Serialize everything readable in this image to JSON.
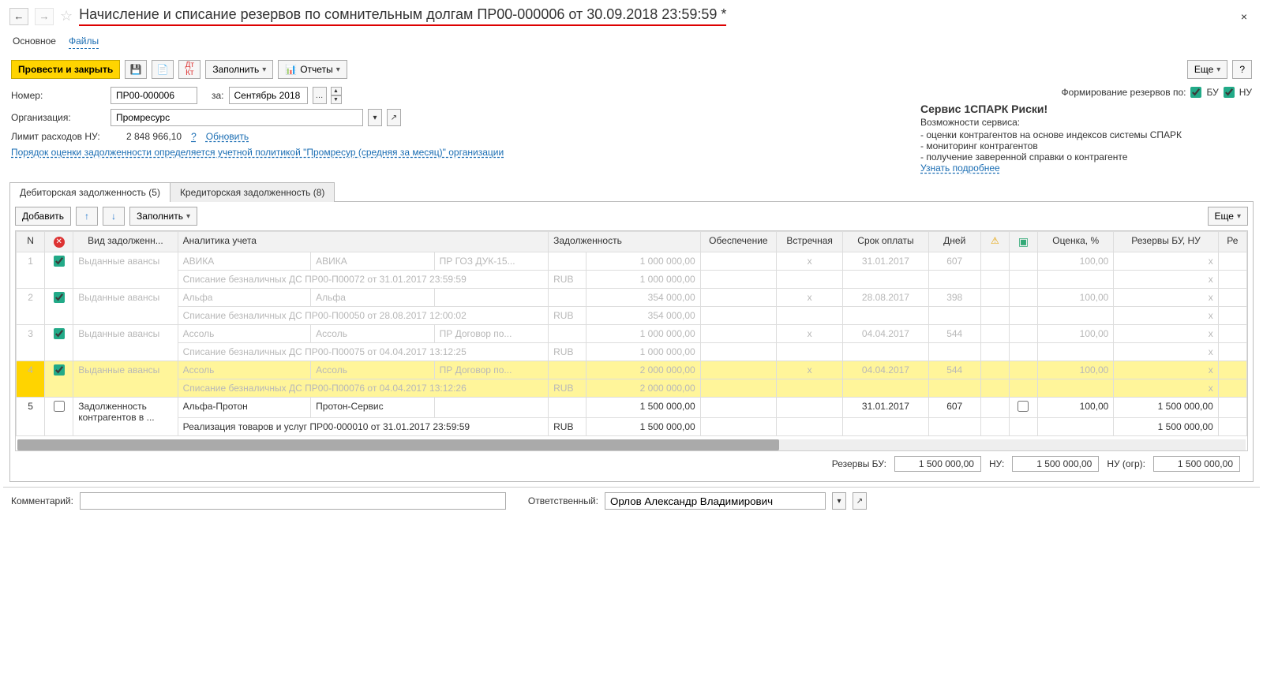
{
  "header": {
    "title": "Начисление и списание резервов по сомнительным долгам ПР00-000006 от 30.09.2018 23:59:59 *"
  },
  "topTabs": {
    "main": "Основное",
    "files": "Файлы"
  },
  "toolbar": {
    "post_close": "Провести и закрыть",
    "fill": "Заполнить",
    "reports": "Отчеты",
    "more": "Еще",
    "help": "?"
  },
  "form": {
    "number_label": "Номер:",
    "number": "ПР00-000006",
    "for_label": "за:",
    "period": "Сентябрь 2018",
    "org_label": "Организация:",
    "org": "Промресурс",
    "limit_label": "Лимит расходов НУ:",
    "limit": "2 848 966,10",
    "update": "Обновить",
    "policy_link": "Порядок оценки задолженности определяется учетной политикой \"Промресур (средняя за месяц)\" организации"
  },
  "right": {
    "form_by_label": "Формирование резервов по:",
    "bu": "БУ",
    "nu": "НУ",
    "spark_title": "Сервис 1СПАРК Риски!",
    "spark_sub": "Возможности сервиса:",
    "b1": "- оценки контрагентов на основе индексов системы СПАРК",
    "b2": "- мониторинг контрагентов",
    "b3": "- получение заверенной справки о контрагенте",
    "learn_more": "Узнать подробнее"
  },
  "tabs": {
    "ar": "Дебиторская задолженность (5)",
    "ap": "Кредиторская задолженность (8)"
  },
  "subToolbar": {
    "add": "Добавить",
    "fill": "Заполнить",
    "more": "Еще"
  },
  "cols": {
    "n": "N",
    "kind": "Вид задолженн...",
    "analytics": "Аналитика учета",
    "debt": "Задолженность",
    "collat": "Обеспечение",
    "counter": "Встречная",
    "due": "Срок оплаты",
    "days": "Дней",
    "eval": "Оценка, %",
    "reserves": "Резервы БУ, НУ",
    "re": "Ре"
  },
  "rows": [
    {
      "n": "1",
      "chk": true,
      "dim": true,
      "kind": "Выданные авансы",
      "a1": "АВИКА",
      "a2": "АВИКА",
      "a3": "ПР ГОЗ ДУК-15...",
      "debt": "1 000 000,00",
      "counter": "x",
      "due": "31.01.2017",
      "days": "607",
      "eval": "100,00",
      "res": "x",
      "sub_desc": "Списание безналичных ДС ПР00-П00072 от 31.01.2017 23:59:59",
      "sub_cur": "RUB",
      "sub_debt": "1 000 000,00",
      "sub_res": "x"
    },
    {
      "n": "2",
      "chk": true,
      "dim": true,
      "kind": "Выданные авансы",
      "a1": "Альфа",
      "a2": "Альфа",
      "a3": "",
      "debt": "354 000,00",
      "counter": "x",
      "due": "28.08.2017",
      "days": "398",
      "eval": "100,00",
      "res": "x",
      "sub_desc": "Списание безналичных ДС ПР00-П00050 от 28.08.2017 12:00:02",
      "sub_cur": "RUB",
      "sub_debt": "354 000,00",
      "sub_res": "x"
    },
    {
      "n": "3",
      "chk": true,
      "dim": true,
      "kind": "Выданные авансы",
      "a1": "Ассоль",
      "a2": "Ассоль",
      "a3": "ПР Договор по...",
      "debt": "1 000 000,00",
      "counter": "x",
      "due": "04.04.2017",
      "days": "544",
      "eval": "100,00",
      "res": "x",
      "sub_desc": "Списание безналичных ДС ПР00-П00075 от 04.04.2017 13:12:25",
      "sub_cur": "RUB",
      "sub_debt": "1 000 000,00",
      "sub_res": "x"
    },
    {
      "n": "4",
      "chk": true,
      "dim": true,
      "yellow": true,
      "kind": "Выданные авансы",
      "a1": "Ассоль",
      "a2": "Ассоль",
      "a3": "ПР Договор по...",
      "debt": "2 000 000,00",
      "counter": "x",
      "due": "04.04.2017",
      "days": "544",
      "eval": "100,00",
      "res": "x",
      "sub_desc": "Списание безналичных ДС ПР00-П00076 от 04.04.2017 13:12:26",
      "sub_cur": "RUB",
      "sub_debt": "2 000 000,00",
      "sub_res": "x"
    },
    {
      "n": "5",
      "chk": false,
      "dim": false,
      "kind": "Задолженность контрагентов в ...",
      "a1": "Альфа-Протон",
      "a2": "Протон-Сервис",
      "a3": "",
      "debt": "1 500 000,00",
      "counter": "",
      "due": "31.01.2017",
      "days": "607",
      "eval": "100,00",
      "res": "1 500 000,00",
      "chk2": false,
      "sub_desc": "Реализация товаров и услуг ПР00-000010 от 31.01.2017 23:59:59",
      "sub_cur": "RUB",
      "sub_debt": "1 500 000,00",
      "sub_res": "1 500 000,00"
    }
  ],
  "totals": {
    "bu_label": "Резервы БУ:",
    "bu": "1 500 000,00",
    "nu_label": "НУ:",
    "nu": "1 500 000,00",
    "nu_ogr_label": "НУ (огр):",
    "nu_ogr": "1 500 000,00"
  },
  "footer": {
    "comment_label": "Комментарий:",
    "resp_label": "Ответственный:",
    "responsible": "Орлов Александр Владимирович"
  }
}
